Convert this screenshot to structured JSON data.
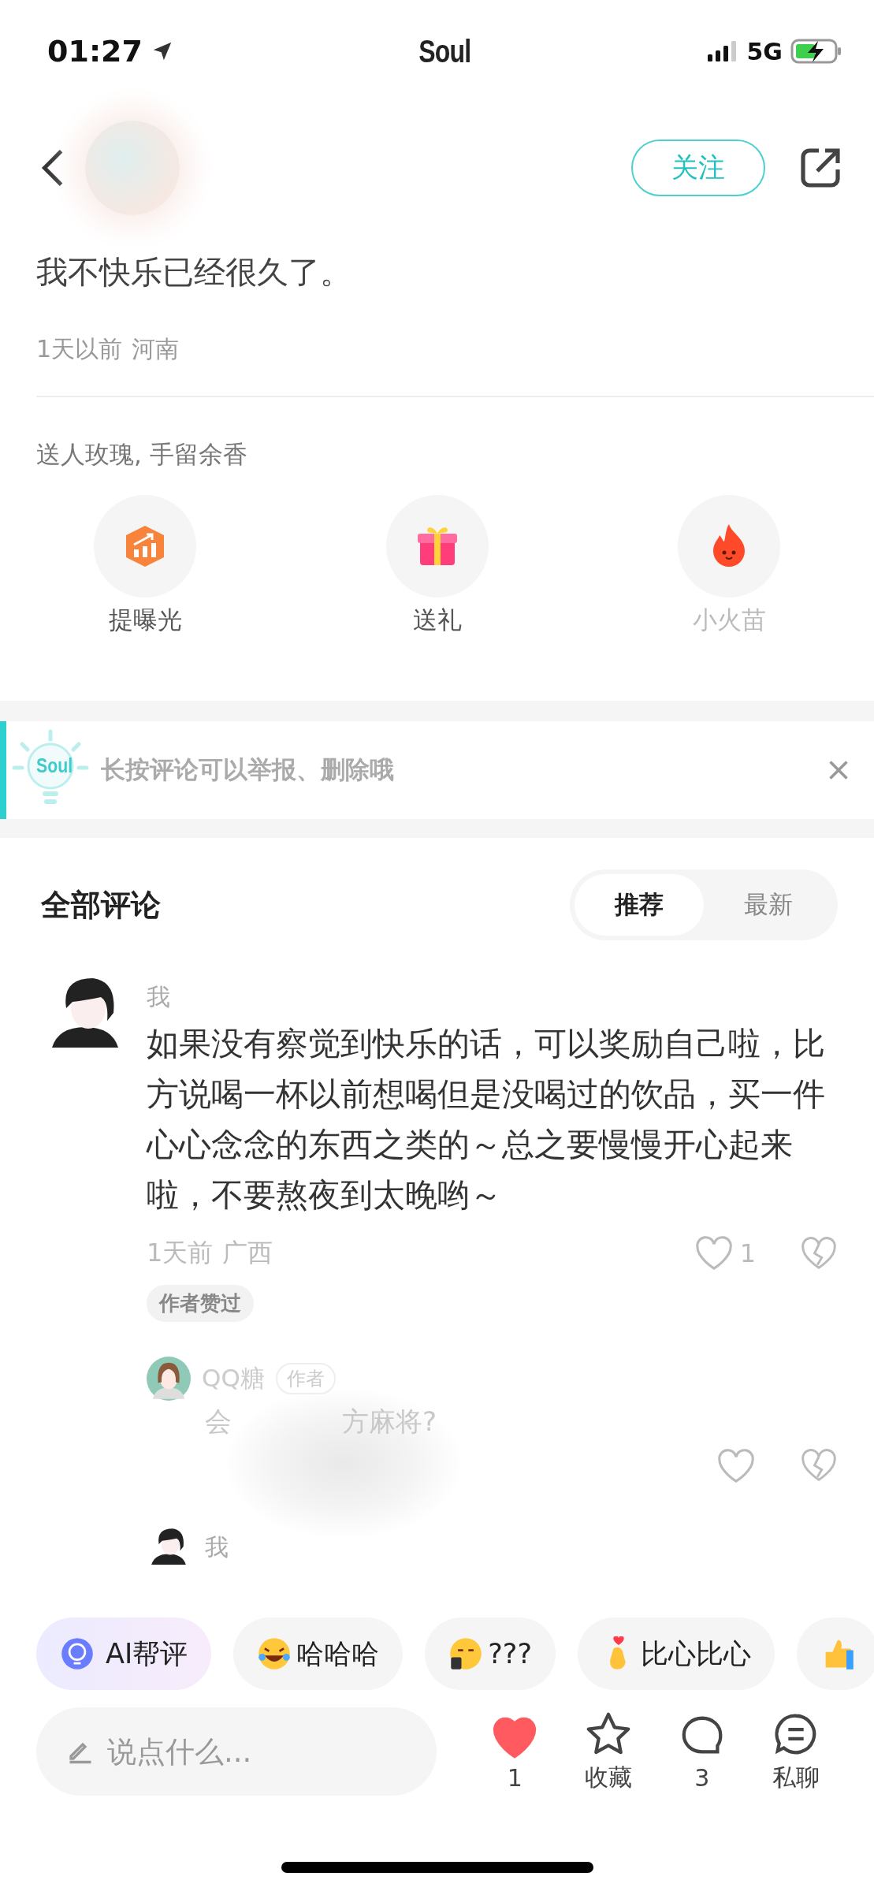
{
  "status_bar": {
    "time": "01:27",
    "app_name": "Soul",
    "network": "5G"
  },
  "header": {
    "follow_button": "关注"
  },
  "post": {
    "text": "我不快乐已经很久了。",
    "time": "1天以前",
    "location": "河南"
  },
  "gifts": {
    "title": "送人玫瑰, 手留余香",
    "items": [
      {
        "kind": "boost",
        "label": "提曝光",
        "disabled": false
      },
      {
        "kind": "gift",
        "label": "送礼",
        "disabled": false
      },
      {
        "kind": "flame",
        "label": "小火苗",
        "disabled": true
      }
    ]
  },
  "tip": {
    "logo": "Soul",
    "text": "长按评论可以举报、删除哦"
  },
  "comments": {
    "title": "全部评论",
    "sort_tabs": [
      {
        "label": "推荐",
        "selected": true
      },
      {
        "label": "最新",
        "selected": false
      }
    ],
    "items": [
      {
        "author": "我",
        "text": "如果没有察觉到快乐的话，可以奖励自己啦，比方说喝一杯以前想喝但是没喝过的饮品，买一件心心念念的东西之类的～总之要慢慢开心起来啦，不要熬夜到太晚哟～",
        "time": "1天前",
        "location": "广西",
        "likes": "1",
        "liked": false,
        "badge": "作者赞过",
        "replies": [
          {
            "author": "QQ糖",
            "author_badge": "作者",
            "text_parts": [
              "会",
              "方麻将?"
            ],
            "liked": false
          }
        ]
      },
      {
        "author": "我"
      }
    ]
  },
  "quick_replies": [
    {
      "kind": "ai",
      "label": "AI帮评"
    },
    {
      "kind": "laugh",
      "label": "哈哈哈"
    },
    {
      "kind": "phone-face",
      "label": "???"
    },
    {
      "kind": "heart-hand",
      "label": "比心比心"
    },
    {
      "kind": "thumb"
    }
  ],
  "bottom_bar": {
    "placeholder": "说点什么...",
    "actions": [
      {
        "kind": "like",
        "label": "1",
        "on": true
      },
      {
        "kind": "star",
        "label": "收藏",
        "on": false
      },
      {
        "kind": "comment",
        "label": "3"
      },
      {
        "kind": "chat",
        "label": "私聊"
      }
    ]
  }
}
